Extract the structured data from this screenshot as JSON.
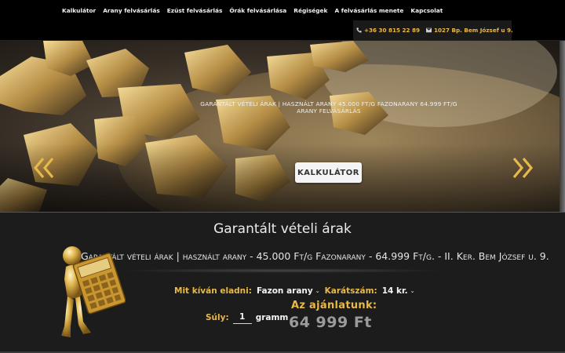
{
  "nav": {
    "items": [
      {
        "label": "Kalkulátor"
      },
      {
        "label": "Arany felvásárlás"
      },
      {
        "label": "Ezüst felvásárlás"
      },
      {
        "label": "Órák felvásárlása"
      },
      {
        "label": "Régiségek"
      },
      {
        "label": "A felvásárlás menete"
      },
      {
        "label": "Kapcsolat"
      }
    ]
  },
  "contact": {
    "phone": "+36 30 815 22 89",
    "address": "1027 Bp. Bem József u 9.",
    "phone_icon": "phone-icon",
    "address_icon": "envelope-icon"
  },
  "hero": {
    "caption_line1": "GARANTÁLT VÉTELI ÁRAK | HASZNÁLT ARANY 45.000 FT/G FAZONARANY 64.999 FT/G",
    "caption_line2": "ARANY FELVÁSÁRLÁS",
    "button_label": "KALKULÁTOR",
    "prev_icon": "double-chevron-left-icon",
    "next_icon": "double-chevron-right-icon"
  },
  "calculator": {
    "title": "Garantált vételi árak",
    "marquee": "Garantált vételi árak | használt arany - 45.000 Ft/g Fazonarany - 64.999 Ft/g. - II. Ker. Bem József u. 9.",
    "sell_label": "Mit kíván eladni:",
    "sell_value": "Fazon arany",
    "karat_label": "Karátszám:",
    "karat_value": "14 kr.",
    "weight_label": "Súly:",
    "weight_value": "1",
    "weight_unit": "gramm",
    "offer_label": "Az ajánlatunk:",
    "offer_value": "64 999 Ft"
  },
  "colors": {
    "accent_gold": "#e8b84a",
    "background_dark": "#1c1c1c",
    "offer_grey": "#9b9b9b"
  }
}
